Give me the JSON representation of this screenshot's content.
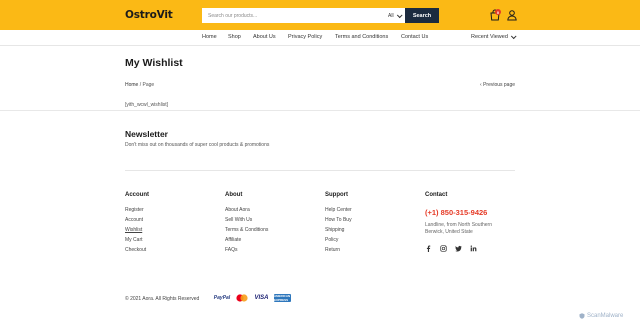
{
  "header": {
    "logo": "OstroVit",
    "search_placeholder": "Search our products...",
    "category": "All",
    "search_button": "Search",
    "cart_count": "0",
    "accent_color": "#fbb915",
    "search_button_color": "#1c2b3f",
    "icons": [
      "cart-icon",
      "user-icon",
      "chevron-down-icon"
    ]
  },
  "nav": {
    "items": [
      "Home",
      "Shop",
      "About Us",
      "Privacy Policy",
      "Terms and Conditions",
      "Contact Us"
    ],
    "recent": "Recent Viewed"
  },
  "page": {
    "title": "My Wishlist",
    "breadcrumb_home": "Home",
    "breadcrumb_sep": "/",
    "breadcrumb_current": "Page",
    "previous": "Previous page",
    "shortcode": "[yith_wcwl_wishlist]"
  },
  "newsletter": {
    "title": "Newsletter",
    "subtitle": "Don't miss out on thousands of super cool products & promotions"
  },
  "footer": {
    "account": {
      "title": "Account",
      "items": [
        "Register",
        "Account",
        "Wishlist",
        "My Cart",
        "Checkout"
      ]
    },
    "about": {
      "title": "About",
      "items": [
        "About Aora",
        "Sell With Us",
        "Terms & Conditions",
        "Affiliate",
        "FAQs"
      ]
    },
    "support": {
      "title": "Support",
      "items": [
        "Help Center",
        "How To Buy",
        "Shipping",
        "Policy",
        "Return"
      ]
    },
    "contact": {
      "title": "Contact",
      "phone": "(+1) 850-315-9426",
      "address": "Landline, from North Southern Berwick, United State",
      "phone_color": "#e53a26",
      "socials": [
        "facebook-icon",
        "instagram-icon",
        "twitter-icon",
        "linkedin-icon"
      ]
    },
    "copyright": "© 2021 Aora. All Rights Reserved",
    "payments": [
      "PayPal",
      "VISA",
      "AMERICAN EXPRESS"
    ]
  },
  "watermark": "ScanMalware"
}
